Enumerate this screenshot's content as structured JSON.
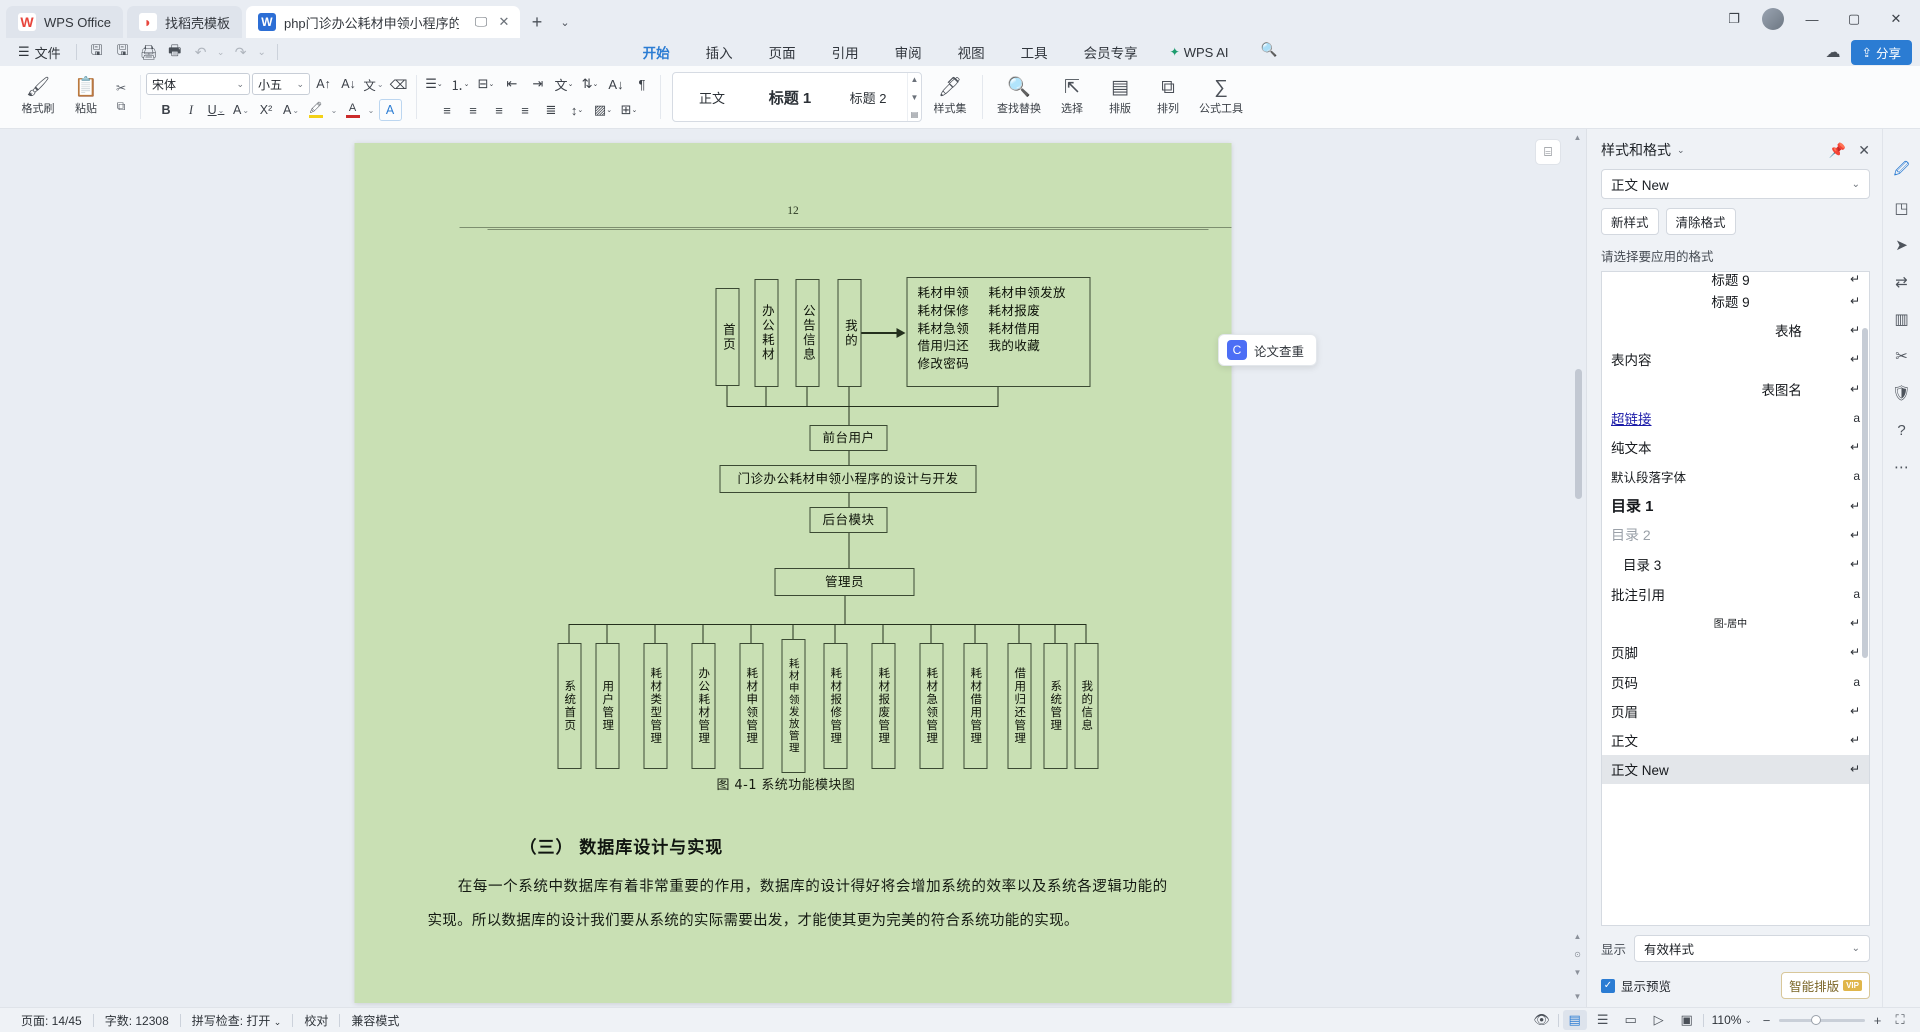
{
  "window": {
    "tabs": [
      {
        "label": "WPS Office",
        "icon": "wps-logo-icon"
      },
      {
        "label": "找稻壳模板",
        "icon": "docer-icon"
      },
      {
        "label": "php门诊办公耗材申领小程序的",
        "icon": "word-doc-icon"
      }
    ],
    "new_tab": "+",
    "controls": {
      "restore": "❐",
      "minimize": "—",
      "maximize": "▢",
      "close": "✕"
    }
  },
  "menu": {
    "file": "文件",
    "quick": [
      "save-icon",
      "save-as-icon",
      "print-icon",
      "print-preview-icon",
      "undo-icon",
      "redo-icon",
      "more-icon"
    ],
    "ribbon_tabs": [
      "开始",
      "插入",
      "页面",
      "引用",
      "审阅",
      "视图",
      "工具",
      "会员专享"
    ],
    "wps_ai": "WPS AI",
    "search": "search-icon",
    "share": "分享",
    "cloud": "cloud-icon"
  },
  "ribbon": {
    "format_painter": "格式刷",
    "paste": "粘贴",
    "cut": "cut-icon",
    "copy": "copy-icon",
    "font_name": "宋体",
    "font_size": "小五",
    "grow_font": "A↑",
    "shrink_font": "A↓",
    "clear_format": "clear-format-icon",
    "bold": "B",
    "italic": "I",
    "underline": "U",
    "strike": "A",
    "superscript": "X²",
    "text_effect": "A",
    "highlight": "highlight-icon",
    "font_color": "font-color-icon",
    "char_shading": "A",
    "styles": [
      "正文",
      "标题 1",
      "标题 2"
    ],
    "style_set": "样式集",
    "find_replace": "查找替换",
    "select": "选择",
    "layout": "排版",
    "sort": "排列",
    "formula": "公式工具"
  },
  "document": {
    "page_number_header": "12",
    "diagram": {
      "top_row": [
        "首页",
        "办公耗材",
        "公告信息",
        "我的"
      ],
      "menu_box": [
        [
          "耗材申领",
          "耗材申领发放"
        ],
        [
          "耗材保修",
          "耗材报废"
        ],
        [
          "耗材急领",
          "耗材借用"
        ],
        [
          "借用归还",
          "我的收藏"
        ],
        [
          "修改密码",
          ""
        ]
      ],
      "front_user": "前台用户",
      "system_title": "门诊办公耗材申领小程序的设计与开发",
      "backend_module": "后台模块",
      "admin": "管理员",
      "modules": [
        "系统首页",
        "用户管理",
        "耗材类型管理",
        "办公耗材管理",
        "耗材申领管理",
        "耗材申领发放管理",
        "耗材报修管理",
        "耗材报废管理",
        "耗材急领管理",
        "耗材借用管理",
        "借用归还管理",
        "系统管理",
        "我的信息"
      ]
    },
    "figure_caption": "图 4-1 系统功能模块图",
    "section_heading": "（三） 数据库设计与实现",
    "paragraph": "在每一个系统中数据库有着非常重要的作用，数据库的设计得好将会增加系统的效率以及系统各逻辑功能的实现。所以数据库的设计我们要从系统的实际需要出发，才能使其更为完美的符合系统功能的实现。",
    "ai_hint": "论文查重"
  },
  "styles_panel": {
    "title": "样式和格式",
    "current_style": "正文 New",
    "new_style": "新样式",
    "clear_format": "清除格式",
    "list_label": "请选择要应用的格式",
    "items": [
      {
        "name": "标题 9",
        "mark": "↵",
        "indent": "center",
        "partial": true
      },
      {
        "name": "标题 9",
        "mark": "↵",
        "indent": "center"
      },
      {
        "name": "表格",
        "mark": "↵",
        "indent": "right"
      },
      {
        "name": "表内容",
        "mark": "↵",
        "indent": "left"
      },
      {
        "name": "表图名",
        "mark": "↵",
        "indent": "right"
      },
      {
        "name": "超链接",
        "mark": "a",
        "indent": "left",
        "style": "link"
      },
      {
        "name": "纯文本",
        "mark": "↵",
        "indent": "left"
      },
      {
        "name": "默认段落字体",
        "mark": "a",
        "indent": "left"
      },
      {
        "name": "目录 1",
        "mark": "↵",
        "indent": "left",
        "style": "bold"
      },
      {
        "name": "目录 2",
        "mark": "↵",
        "indent": "left",
        "style": "gray"
      },
      {
        "name": "目录 3",
        "mark": "↵",
        "indent": "left2"
      },
      {
        "name": "批注引用",
        "mark": "a",
        "indent": "left"
      },
      {
        "name": "图-居中",
        "mark": "↵",
        "indent": "center",
        "style": "small"
      },
      {
        "name": "页脚",
        "mark": "↵",
        "indent": "left"
      },
      {
        "name": "页码",
        "mark": "a",
        "indent": "left"
      },
      {
        "name": "页眉",
        "mark": "↵",
        "indent": "left"
      },
      {
        "name": "正文",
        "mark": "↵",
        "indent": "left"
      },
      {
        "name": "正文 New",
        "mark": "↵",
        "indent": "left",
        "selected": true
      }
    ],
    "show_label": "显示",
    "show_value": "有效样式",
    "preview_label": "显示预览",
    "smart_layout": "智能排版",
    "vip_badge": "VIP"
  },
  "status_bar": {
    "page": "页面: 14/45",
    "words": "字数: 12308",
    "spellcheck": "拼写检查: 打开",
    "proof": "校对",
    "compat": "兼容模式",
    "zoom": "110%"
  },
  "colors": {
    "accent": "#2b7cd3",
    "page_bg": "#c9e0b4",
    "chrome_bg": "#e9edf3",
    "vip": "#e0b64b"
  }
}
